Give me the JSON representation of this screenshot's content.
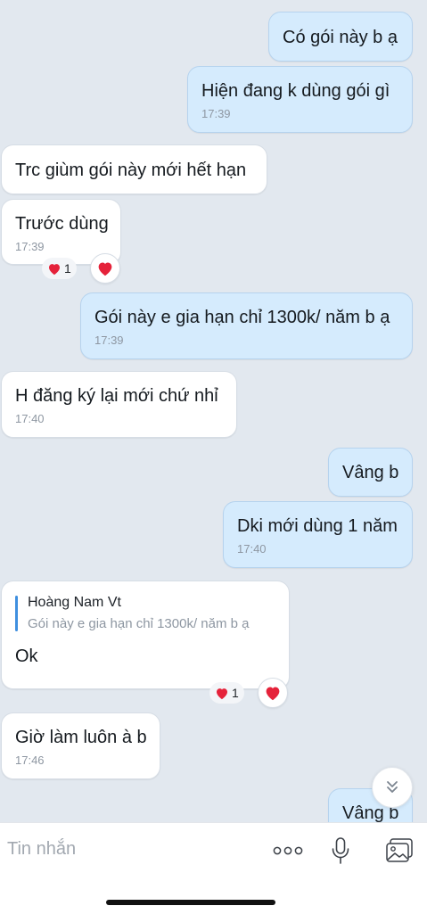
{
  "messages": [
    {
      "dir": "out",
      "text": "Có gói này b ạ"
    },
    {
      "dir": "out",
      "text": "Hiện đang k dùng gói gì",
      "time": "17:39"
    },
    {
      "dir": "in",
      "text": "Trc giùm gói này mới hết hạn"
    },
    {
      "dir": "in",
      "text": "Trước dùng",
      "time": "17:39",
      "reaction_count": "1"
    },
    {
      "dir": "out",
      "text": "Gói này e gia hạn chỉ 1300k/ năm b ạ",
      "time": "17:39"
    },
    {
      "dir": "in",
      "text": "H đăng ký lại mới chứ nhỉ",
      "time": "17:40"
    },
    {
      "dir": "out",
      "text": "Vâng b"
    },
    {
      "dir": "out",
      "text": "Dki mới dùng 1 năm",
      "time": "17:40"
    },
    {
      "dir": "in",
      "quote_name": "Hoàng Nam Vt",
      "quote_text": "Gói này e gia hạn chỉ 1300k/ năm b ạ",
      "text": "Ok",
      "reaction_count": "1"
    },
    {
      "dir": "in",
      "text": "Giờ làm luôn à b",
      "time": "17:46"
    },
    {
      "dir": "out",
      "text": "Vâng b"
    }
  ],
  "input": {
    "placeholder": "Tin nhắn"
  },
  "icons": {
    "reaction": "heart-icon",
    "scroll": "double-chevron-down-icon",
    "more": "more-icon",
    "mic": "microphone-icon",
    "image": "image-icon"
  },
  "colors": {
    "background": "#e2e8ef",
    "incoming_bubble": "#ffffff",
    "outgoing_bubble": "#d5ebfd",
    "heart": "#e5223a",
    "quote_bar": "#3f8fdf"
  }
}
